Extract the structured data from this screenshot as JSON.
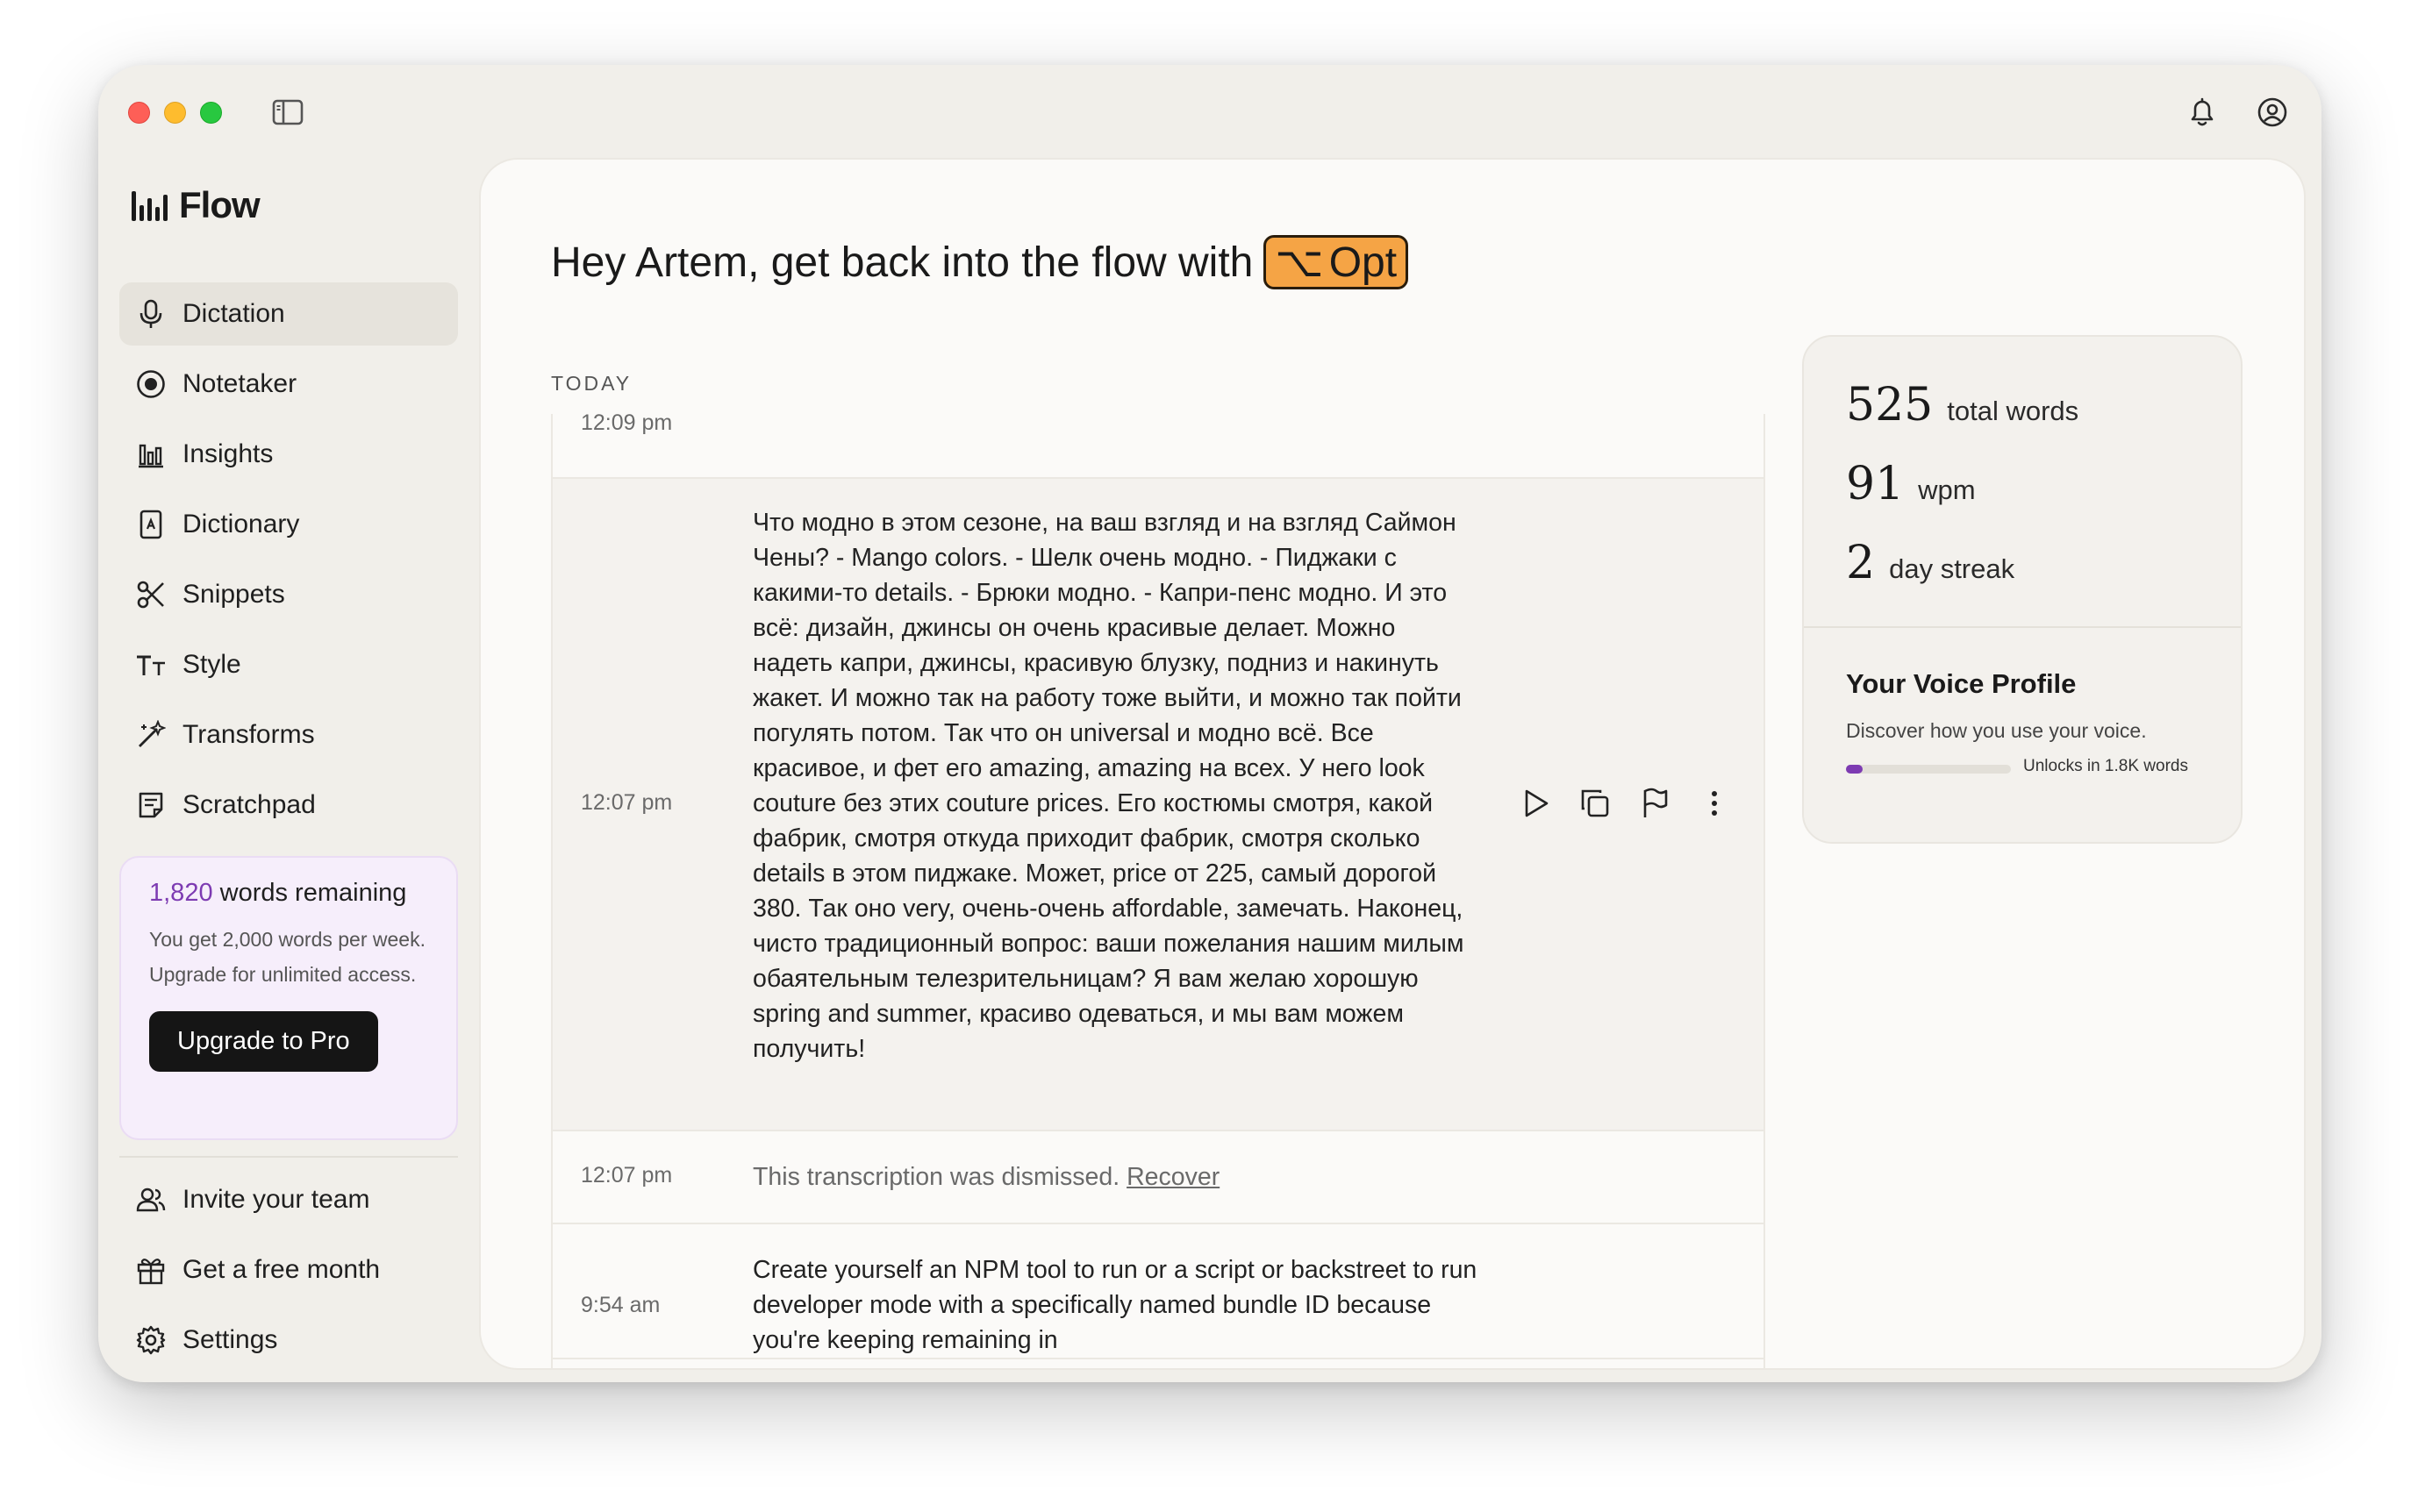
{
  "app": {
    "name": "Flow"
  },
  "sidebar": {
    "items": [
      {
        "label": "Dictation",
        "icon": "microphone-icon",
        "active": true
      },
      {
        "label": "Notetaker",
        "icon": "record-icon"
      },
      {
        "label": "Insights",
        "icon": "bar-chart-icon"
      },
      {
        "label": "Dictionary",
        "icon": "book-icon"
      },
      {
        "label": "Snippets",
        "icon": "scissors-icon"
      },
      {
        "label": "Style",
        "icon": "text-style-icon"
      },
      {
        "label": "Transforms",
        "icon": "magic-wand-icon"
      },
      {
        "label": "Scratchpad",
        "icon": "notepad-icon"
      }
    ],
    "promo": {
      "count": "1,820",
      "title_suffix": " words remaining",
      "description": "You get 2,000 words per week. Upgrade for unlimited access.",
      "button": "Upgrade to Pro"
    },
    "bottom_items": [
      {
        "label": "Invite your team",
        "icon": "users-icon"
      },
      {
        "label": "Get a free month",
        "icon": "gift-icon"
      },
      {
        "label": "Settings",
        "icon": "gear-icon"
      }
    ]
  },
  "main": {
    "greeting": "Hey Artem, get back into the flow with",
    "shortcut_symbol": "⌥",
    "shortcut_label": "Opt",
    "section_label": "TODAY",
    "entries": [
      {
        "time": "12:09 pm"
      },
      {
        "time": "12:07 pm",
        "text": "Что модно в этом сезоне, на ваш взгляд и на взгляд Саймон Чены? - Mango colors. - Шелк очень модно. - Пиджаки с какими-то details. - Брюки модно. - Капри-пенс модно. И это всё: дизайн, джинсы он очень красивые делает. Можно надеть капри, джинсы, красивую блузку, подниз и накинуть жакет. И можно так на работу тоже выйти, и можно так пойти погулять потом. Так что он universal и модно всё. Все красивое, и фет его amazing, amazing на всех. У него look couture без этих couture prices. Его костюмы смотря, какой фабрик, смотря откуда приходит фабрик, смотря сколько details в этом пиджаке. Может, price от 225, самый дорогой 380. Так оно very, очень-очень affordable, замечать. Наконец, чисто традиционный вопрос: ваши пожелания нашим милым обаятельным телезрительницам? Я вам желаю хорошую spring and summer, красиво одеваться, и мы вам можем получить!"
      },
      {
        "time": "12:07 pm",
        "text": "This transcription was dismissed.",
        "link": "Recover"
      },
      {
        "time": "9:54 am",
        "text": "Create yourself an NPM tool to run or a script or backstreet to run developer mode with a specifically named bundle ID because you're keeping remaining in"
      }
    ]
  },
  "stats": {
    "total_words": "525",
    "total_words_label": "total words",
    "wpm": "91",
    "wpm_label": "wpm",
    "streak": "2",
    "streak_label": "day streak",
    "voice_profile_title": "Your Voice Profile",
    "voice_profile_desc": "Discover how you use your voice.",
    "voice_profile_progress": 0.1,
    "voice_profile_unlock": "Unlocks in 1.8K words"
  },
  "colors": {
    "accent_purple": "#7d3bb2",
    "shortcut_orange": "#f5a445"
  }
}
